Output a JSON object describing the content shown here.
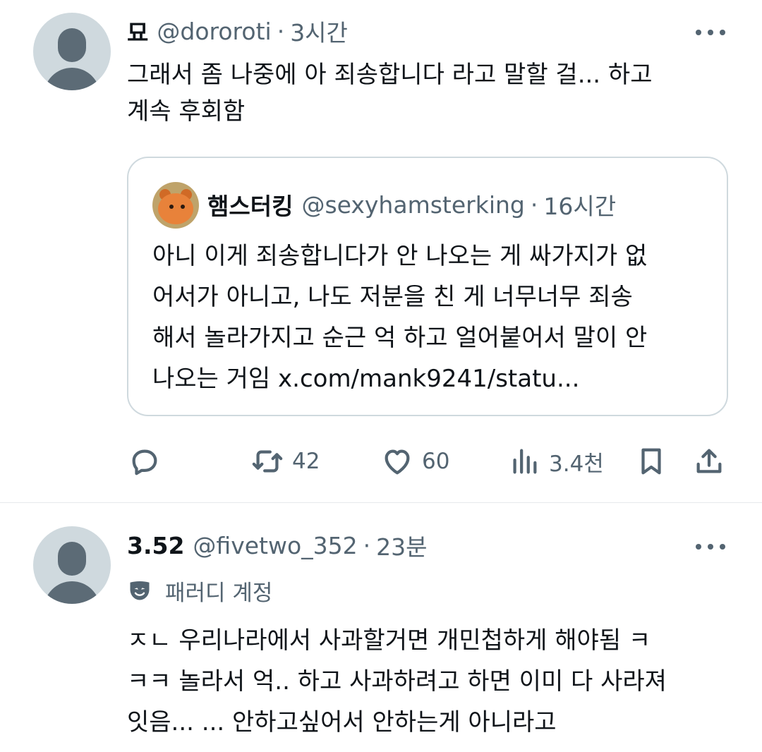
{
  "tweet1": {
    "name": "묘",
    "handle": "@dororoti",
    "separator": "·",
    "time": "3시간",
    "text": "그래서 좀 나중에 아 죄송합니다 라고 말할 걸... 하고\n계속 후회함",
    "quote": {
      "name": "햄스터킹",
      "handle": "@sexyhamsterking",
      "separator": "·",
      "time": "16시간",
      "text": "아니 이게 죄송합니다가 안 나오는 게 싸가지가 없\n어서가 아니고, 나도 저분을 친 게 너무너무 죄송\n해서 놀라가지고 순근 억 하고 얼어붙어서 말이 안\n나오는 거임 x.com/mank9241/statu..."
    },
    "actions": {
      "reply_icon": "reply-icon",
      "retweet_icon": "retweet-icon",
      "retweets": "42",
      "like_icon": "heart-icon",
      "likes": "60",
      "views_icon": "views-chart-icon",
      "views": "3.4천",
      "bookmark_icon": "bookmark-icon",
      "share_icon": "share-icon"
    }
  },
  "tweet2": {
    "name": "3.52",
    "handle": "@fivetwo_352",
    "separator": "·",
    "time": "23분",
    "parody_label": "패러디 계정",
    "text": "ㅈㄴ 우리나라에서 사과할거면 개민첩하게 해야됨 ㅋ\nㅋㅋ 놀라서 억.. 하고 사과하려고 하면 이미 다 사라져\n잇음... ... 안하고싶어서 안하는게 아니라고"
  },
  "colors": {
    "text_primary": "#0f1419",
    "text_secondary": "#536471",
    "border": "#cfd9de",
    "avatar_bg": "#cfd9de"
  }
}
